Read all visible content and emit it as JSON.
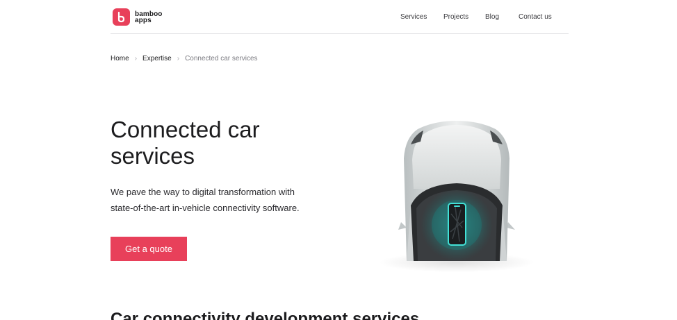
{
  "brand": {
    "logo_line1": "bamboo",
    "logo_line2": "apps",
    "accent_color": "#e8405a"
  },
  "nav": {
    "items": [
      {
        "label": "Services"
      },
      {
        "label": "Projects"
      },
      {
        "label": "Blog"
      },
      {
        "label": "Contact us"
      }
    ]
  },
  "breadcrumb": {
    "items": [
      "Home",
      "Expertise",
      "Connected car services"
    ]
  },
  "hero": {
    "title": "Connected car services",
    "description": "We pave the way to digital transformation with state-of-the-art in-vehicle connectivity software.",
    "cta_label": "Get a quote"
  },
  "next_section": {
    "title": "Car connectivity development services"
  },
  "icons": {
    "logo": "bamboo-logo-icon",
    "breadcrumb_separator": "chevron-right-icon",
    "illustration": "connected-car-illustration"
  }
}
